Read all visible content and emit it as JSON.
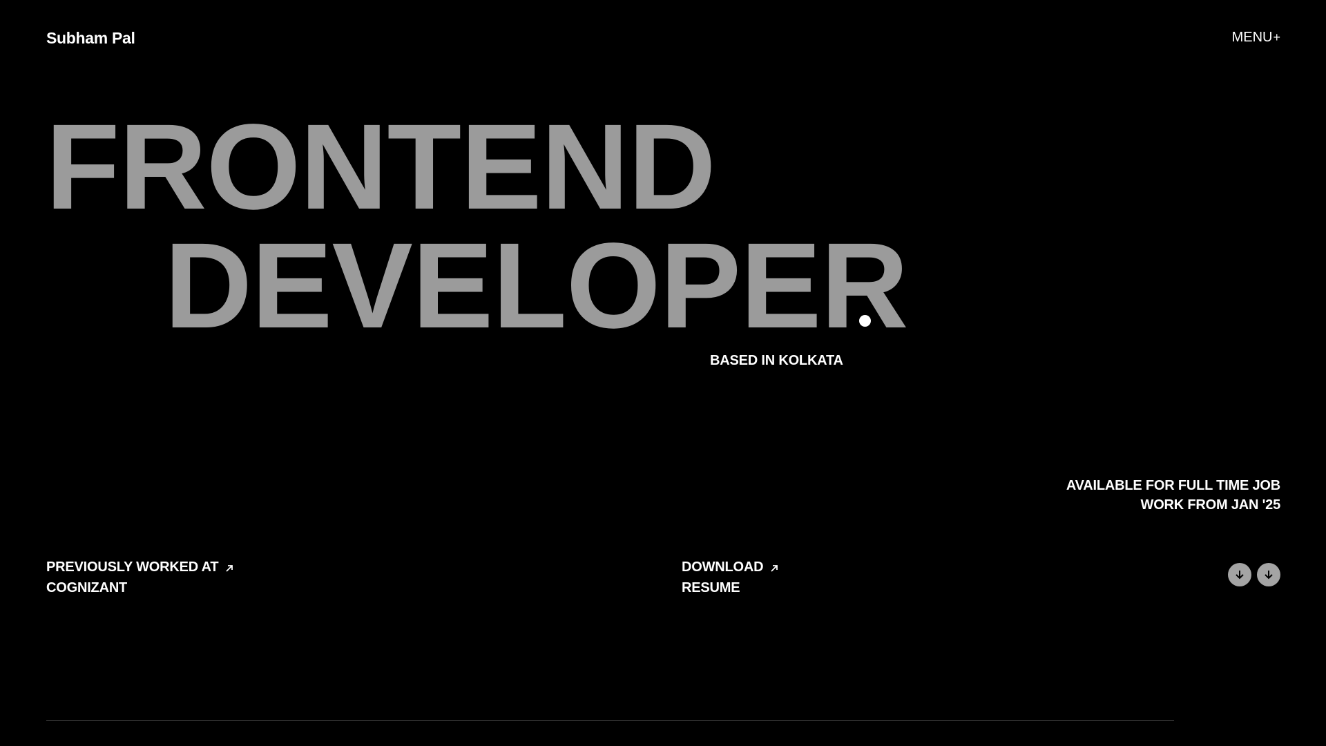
{
  "header": {
    "brand": "Subham Pal",
    "menu_label": "MENU",
    "menu_suffix": "+"
  },
  "hero": {
    "line1": "FRONTEND",
    "line2": "DEVELOPER",
    "location": "BASED IN KOLKATA"
  },
  "availability": {
    "line1": "AVAILABLE FOR FULL TIME JOB",
    "line2": "WORK FROM JAN '25"
  },
  "links": {
    "previous_line1": "PREVIOUSLY WORKED AT",
    "previous_line2": "COGNIZANT",
    "resume_line1": "DOWNLOAD",
    "resume_line2": "RESUME"
  },
  "icons": {
    "external": "arrow-up-right-icon",
    "scroll": "arrow-down-icon"
  },
  "colors": {
    "background": "#000000",
    "hero_text": "#9b9b9b",
    "text": "#ffffff",
    "button_bg": "#a4a4a4"
  }
}
